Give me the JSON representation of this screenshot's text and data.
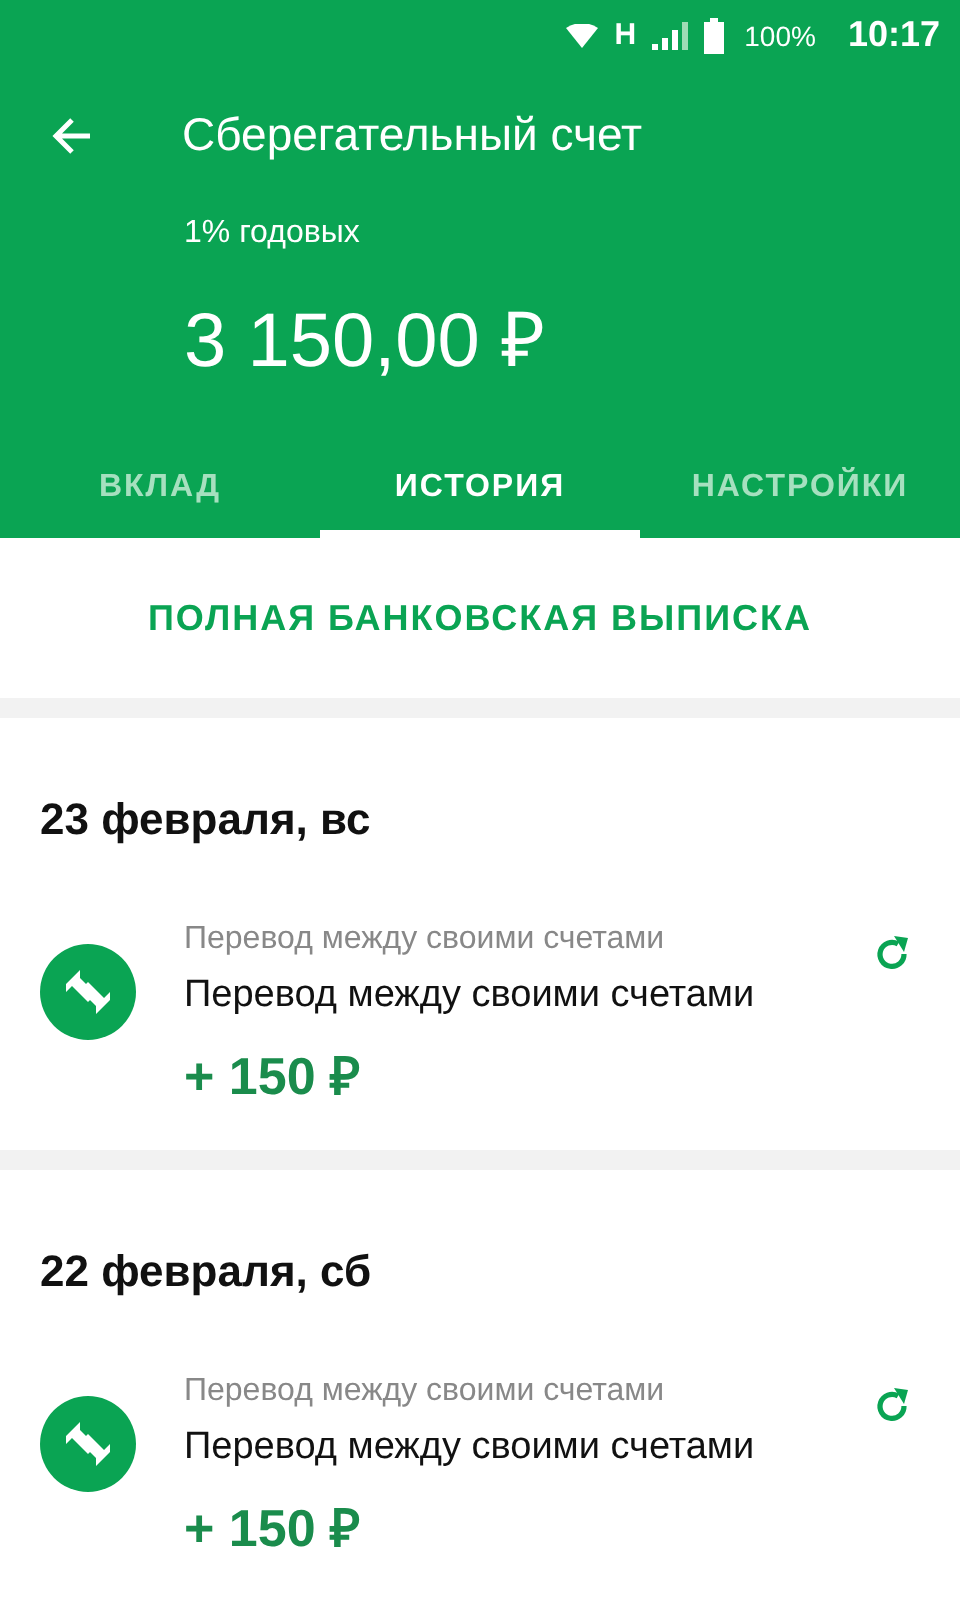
{
  "status_bar": {
    "network": "H",
    "battery": "100%",
    "time": "10:17"
  },
  "header": {
    "title": "Сберегательный счет",
    "rate": "1% годовых",
    "balance": "3 150,00 ₽"
  },
  "tabs": [
    {
      "label": "ВКЛАД",
      "selected": false
    },
    {
      "label": "ИСТОРИЯ",
      "selected": true
    },
    {
      "label": "НАСТРОЙКИ",
      "selected": false
    }
  ],
  "statement_button": "ПОЛНАЯ БАНКОВСКАЯ ВЫПИСКА",
  "days": [
    {
      "date": "23 февраля, вс",
      "operations": [
        {
          "category": "Перевод между своими счетами",
          "title": "Перевод между своими счетами",
          "amount": "+ 150 ₽"
        }
      ]
    },
    {
      "date": "22 февраля, сб",
      "operations": [
        {
          "category": "Перевод между своими счетами",
          "title": "Перевод между своими счетами",
          "amount": "+ 150 ₽"
        }
      ]
    }
  ]
}
